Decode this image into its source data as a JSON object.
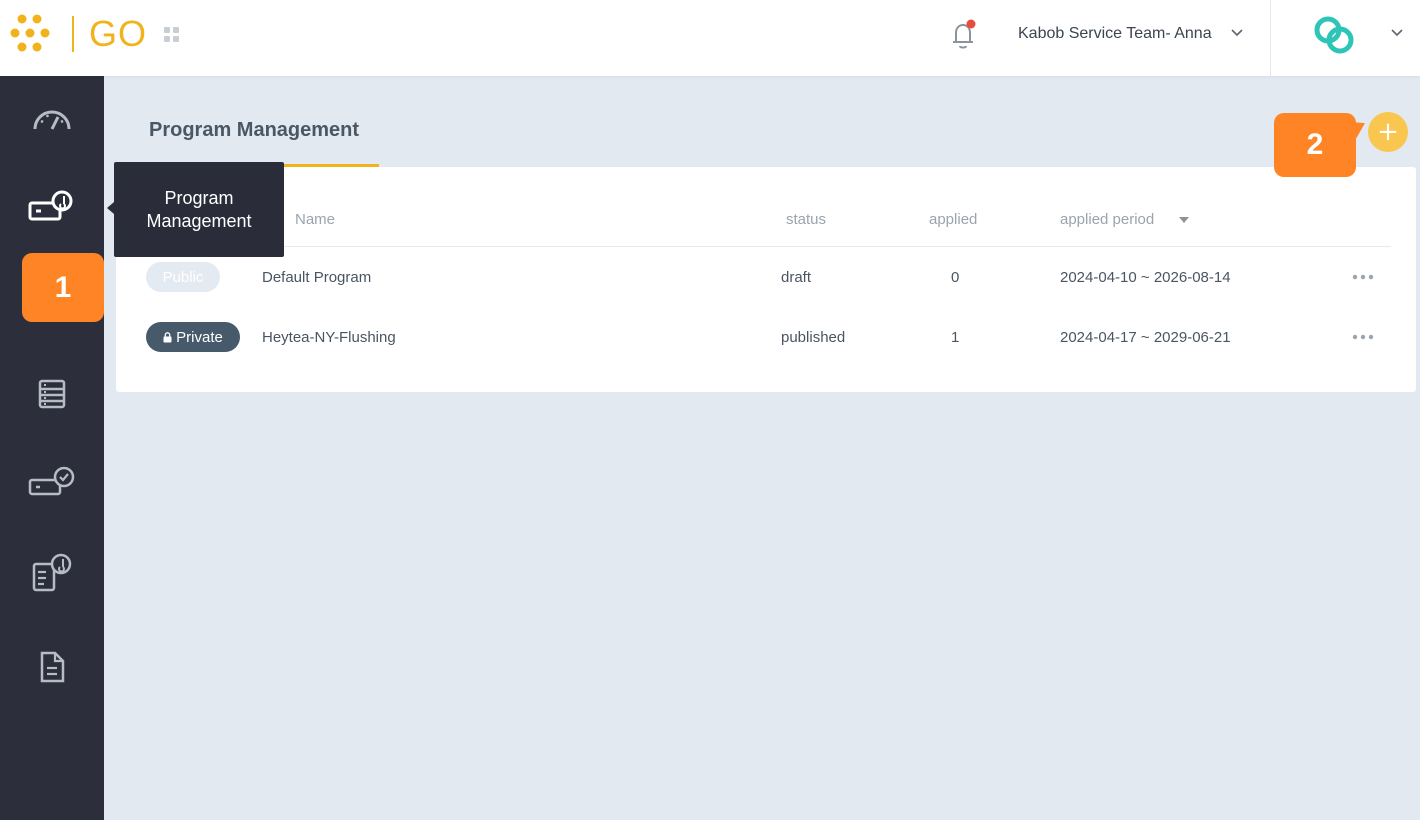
{
  "header": {
    "logo_text": "GO",
    "team_name": "Kabob Service Team- Anna",
    "colors": {
      "accent": "#f2b21c",
      "brand_teal": "#2ec4b6",
      "notification_dot": "#e74c3c"
    }
  },
  "sidebar": {
    "items": [
      {
        "icon": "dashboard-gauge-icon"
      },
      {
        "icon": "program-ticket-icon"
      },
      {
        "icon": "list-table-icon"
      },
      {
        "icon": "ticket-check-icon"
      },
      {
        "icon": "document-ticket-icon"
      },
      {
        "icon": "document-icon"
      }
    ]
  },
  "tooltip": {
    "line1": "Program",
    "line2": "Management"
  },
  "steps": {
    "one": "1",
    "two": "2"
  },
  "page": {
    "title": "Program Management",
    "add_label": "+"
  },
  "table": {
    "headers": {
      "name": "Name",
      "status": "status",
      "applied": "applied",
      "period": "applied period"
    },
    "rows": [
      {
        "badge": "Public",
        "name": "Default Program",
        "status": "draft",
        "applied": "0",
        "period": "2024-04-10 ~ 2026-08-14"
      },
      {
        "badge": "Private",
        "name": "Heytea-NY-Flushing",
        "status": "published",
        "applied": "1",
        "period": "2024-04-17 ~ 2029-06-21"
      }
    ]
  }
}
